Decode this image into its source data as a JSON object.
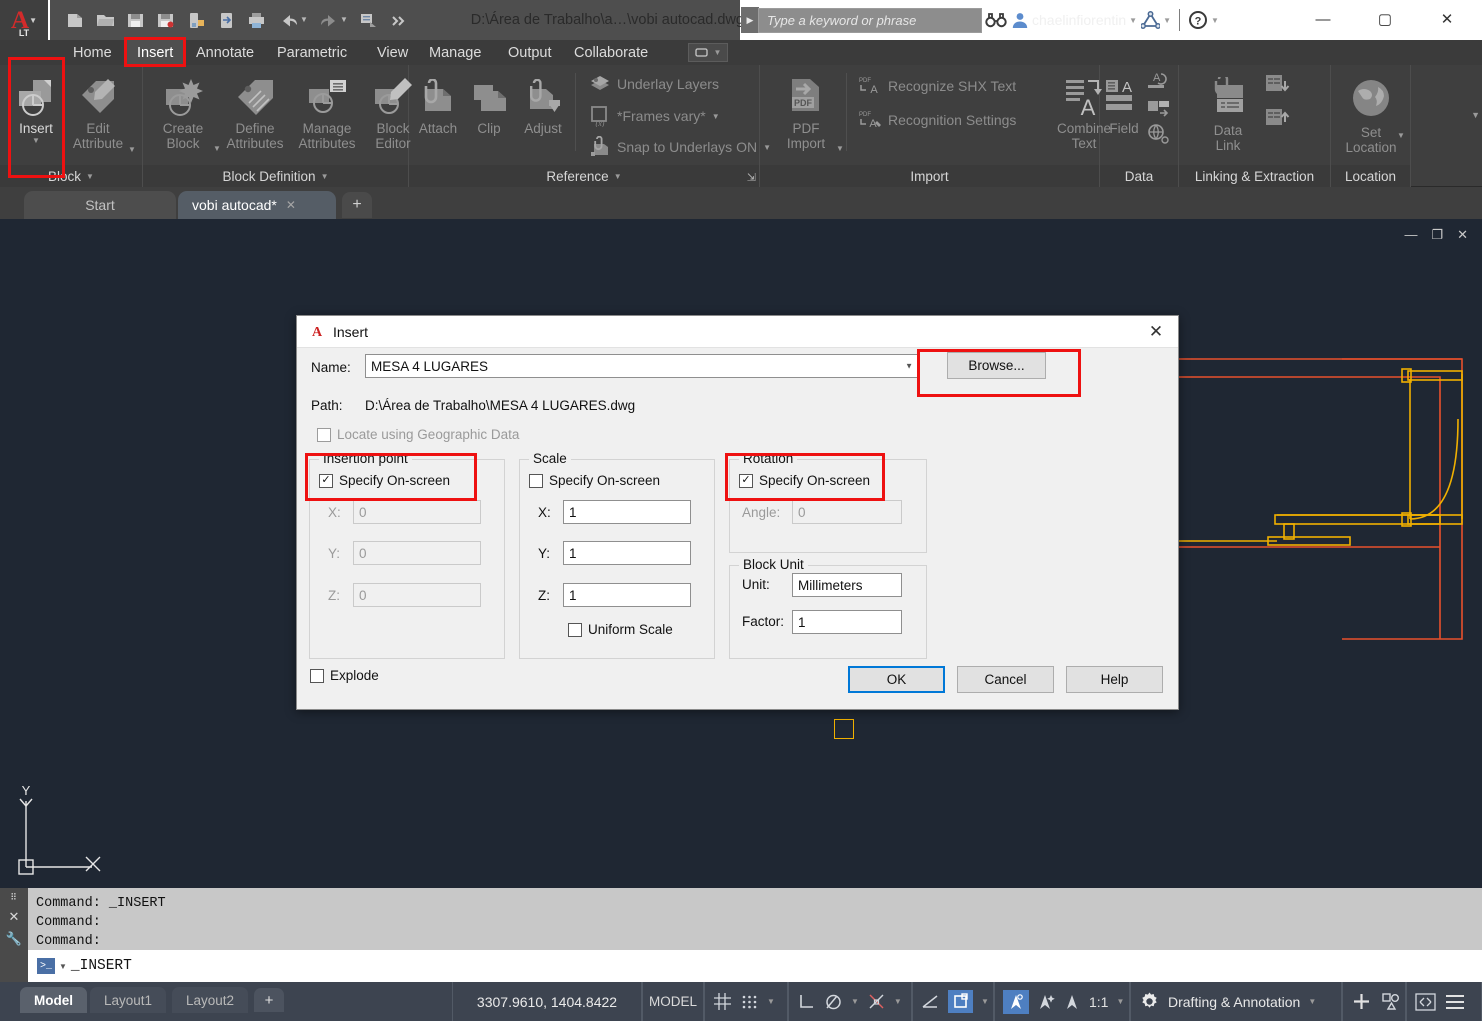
{
  "app": {
    "product_badge": "A",
    "product_badge_sub": "LT",
    "document_title": "D:\\Área de Trabalho\\a…\\vobi autocad.dwg",
    "search_placeholder": "Type a keyword or phrase",
    "user_name": "chaelinfiorentin"
  },
  "quick_access": [
    {
      "name": "new-icon",
      "label": "New"
    },
    {
      "name": "open-icon",
      "label": "Open"
    },
    {
      "name": "save-icon",
      "label": "Save"
    },
    {
      "name": "save-as-icon",
      "label": "Save As"
    },
    {
      "name": "plot-to-device-icon",
      "label": "Plot"
    },
    {
      "name": "export-icon",
      "label": "Export"
    },
    {
      "name": "print-icon",
      "label": "Print"
    },
    {
      "name": "undo-icon",
      "label": "Undo"
    },
    {
      "name": "redo-icon",
      "label": "Redo"
    },
    {
      "name": "batch-plot-icon",
      "label": "Batch Plot"
    },
    {
      "name": "more-icon",
      "label": "More"
    }
  ],
  "window_buttons": {
    "minimize": "—",
    "maximize": "▢",
    "close": "✕"
  },
  "ribbon_tabs": [
    {
      "label": "Home",
      "active": false
    },
    {
      "label": "Insert",
      "active": true
    },
    {
      "label": "Annotate",
      "active": false
    },
    {
      "label": "Parametric",
      "active": false
    },
    {
      "label": "View",
      "active": false
    },
    {
      "label": "Manage",
      "active": false
    },
    {
      "label": "Output",
      "active": false
    },
    {
      "label": "Collaborate",
      "active": false
    }
  ],
  "ribbon_panels": [
    {
      "title": "Block",
      "buttons": [
        {
          "label": "Insert",
          "enabled": true,
          "has_dropdown": true
        },
        {
          "label": "Edit\nAttribute",
          "enabled": false,
          "has_dropdown": true
        }
      ]
    },
    {
      "title": "Block Definition",
      "buttons": [
        {
          "label": "Create\nBlock",
          "enabled": false,
          "has_dropdown": true
        },
        {
          "label": "Define\nAttributes",
          "enabled": false,
          "has_dropdown": false
        },
        {
          "label": "Manage\nAttributes",
          "enabled": false,
          "has_dropdown": false
        },
        {
          "label": "Block\nEditor",
          "enabled": false,
          "has_dropdown": false
        }
      ]
    },
    {
      "title": "Reference",
      "buttons": [
        {
          "label": "Attach",
          "enabled": false
        },
        {
          "label": "Clip",
          "enabled": false
        },
        {
          "label": "Adjust",
          "enabled": false
        }
      ],
      "rows": [
        {
          "label": "Underlay Layers",
          "has_dropdown": false
        },
        {
          "label": "*Frames vary*",
          "has_dropdown": true
        },
        {
          "label": "Snap to Underlays ON",
          "has_dropdown": true
        }
      ]
    },
    {
      "title": "Import",
      "buttons": [
        {
          "label": "PDF\nImport",
          "enabled": false,
          "has_dropdown": true
        },
        {
          "label": "Combine\nText",
          "enabled": false
        }
      ],
      "rows": [
        {
          "label": "Recognize SHX Text"
        },
        {
          "label": "Recognition Settings"
        }
      ]
    },
    {
      "title": "Data",
      "buttons": [
        {
          "label": "Field",
          "enabled": false
        }
      ]
    },
    {
      "title": "Linking & Extraction",
      "buttons": [
        {
          "label": "Data\nLink",
          "enabled": false
        }
      ]
    },
    {
      "title": "Location",
      "buttons": [
        {
          "label": "Set\nLocation",
          "enabled": false,
          "has_dropdown": true
        }
      ]
    }
  ],
  "file_tabs": [
    {
      "label": "Start",
      "active": false,
      "closable": false
    },
    {
      "label": "vobi autocad*",
      "active": true,
      "closable": true
    }
  ],
  "file_tab_add": "+",
  "dialog": {
    "title": "Insert",
    "close": "✕",
    "name_label": "Name:",
    "name_value": "MESA 4 LUGARES",
    "browse_label": "Browse...",
    "path_label": "Path:",
    "path_value": "D:\\Área de Trabalho\\MESA 4 LUGARES.dwg",
    "geo_checkbox_label": "Locate using Geographic Data",
    "geo_checked": false,
    "insertion_point": {
      "title": "Insertion point",
      "specify_label": "Specify On-screen",
      "specify_checked": true,
      "x_label": "X:",
      "x_value": "0",
      "y_label": "Y:",
      "y_value": "0",
      "z_label": "Z:",
      "z_value": "0"
    },
    "scale": {
      "title": "Scale",
      "specify_label": "Specify On-screen",
      "specify_checked": false,
      "x_label": "X:",
      "x_value": "1",
      "y_label": "Y:",
      "y_value": "1",
      "z_label": "Z:",
      "z_value": "1",
      "uniform_label": "Uniform Scale",
      "uniform_checked": false
    },
    "rotation": {
      "title": "Rotation",
      "specify_label": "Specify On-screen",
      "specify_checked": true,
      "angle_label": "Angle:",
      "angle_value": "0"
    },
    "block_unit": {
      "title": "Block Unit",
      "unit_label": "Unit:",
      "unit_value": "Millimeters",
      "factor_label": "Factor:",
      "factor_value": "1"
    },
    "explode_label": "Explode",
    "explode_checked": false,
    "ok_label": "OK",
    "cancel_label": "Cancel",
    "help_label": "Help"
  },
  "command_line": {
    "history": [
      "Command: _INSERT",
      "Command:",
      "Command:"
    ],
    "input_value": "_INSERT"
  },
  "layout_tabs": [
    {
      "label": "Model",
      "active": true
    },
    {
      "label": "Layout1",
      "active": false
    },
    {
      "label": "Layout2",
      "active": false
    }
  ],
  "layout_tab_add": "+",
  "status_bar": {
    "coordinates": "3307.9610, 1404.8422",
    "space": "MODEL",
    "scale": "1:1",
    "workspace": "Drafting & Annotation",
    "items": [
      {
        "name": "grid-display-icon",
        "label": "Grid Display"
      },
      {
        "name": "snap-mode-icon",
        "label": "Snap Mode"
      },
      {
        "name": "ortho-mode-icon",
        "label": "Ortho Mode"
      },
      {
        "name": "polar-tracking-icon",
        "label": "Polar Tracking"
      },
      {
        "name": "object-snap-tracking-icon",
        "label": "Object Snap Tracking"
      },
      {
        "name": "object-snap-icon",
        "label": "Object Snap"
      },
      {
        "name": "lineweight-icon",
        "label": "Show/Hide Lineweight"
      },
      {
        "name": "annotation-visibility-icon",
        "label": "Annotation Visibility"
      },
      {
        "name": "autoscale-icon",
        "label": "AutoScale"
      },
      {
        "name": "annotation-scale-icon",
        "label": "Annotation Scale"
      },
      {
        "name": "workspace-switch-icon",
        "label": "Workspace Switching"
      },
      {
        "name": "customization-icon",
        "label": "Customization"
      }
    ]
  },
  "colors": {
    "highlight_red": "#ee1111",
    "canvas_bg": "#1f2733",
    "drawing_red": "#e8502c",
    "drawing_yellow": "#f0b000",
    "accent_blue": "#0078d7",
    "ribbon_bg": "#3f3f3f"
  },
  "ucs_icon": {
    "x_label": "",
    "y_label": "Y"
  }
}
